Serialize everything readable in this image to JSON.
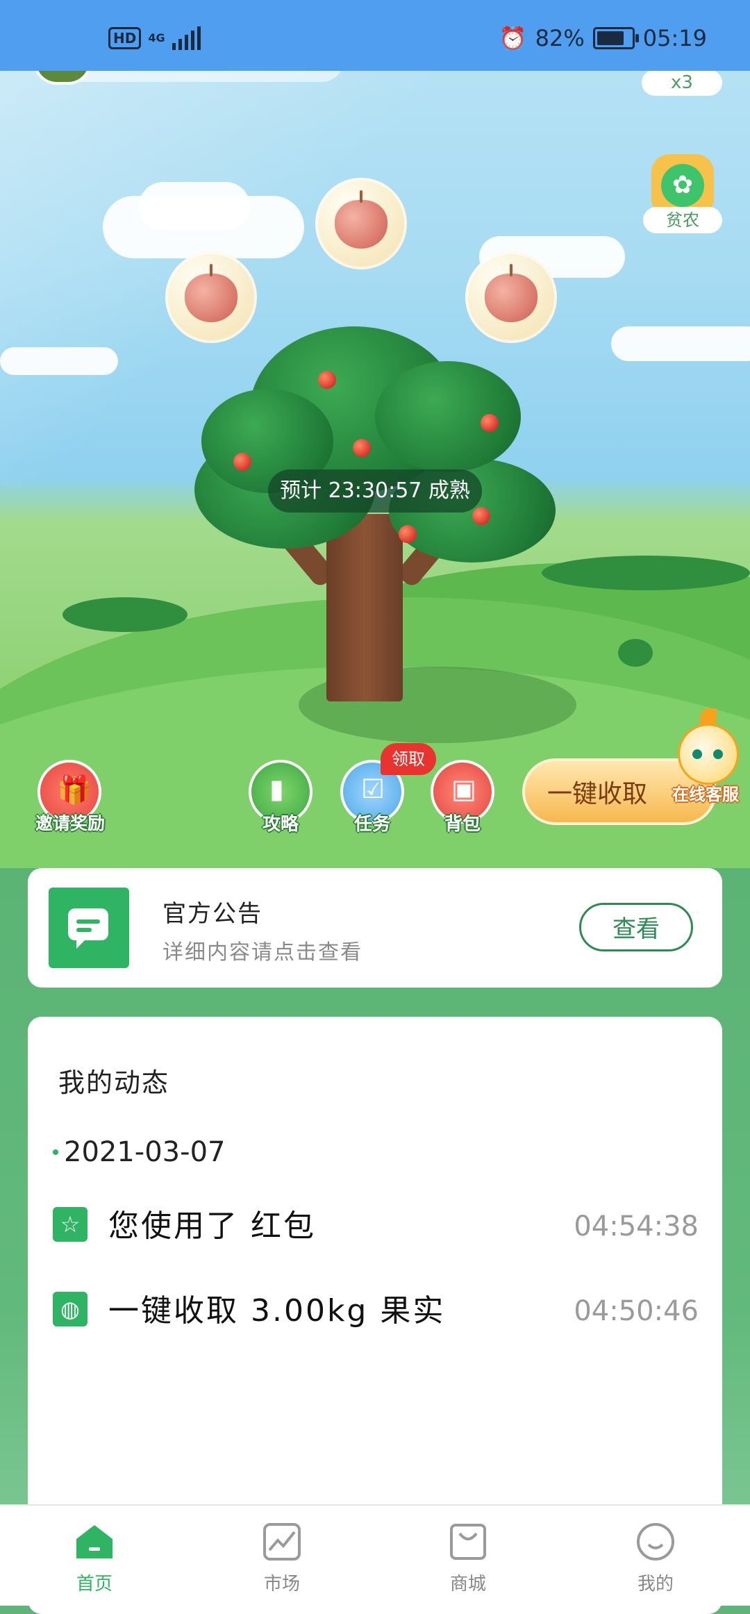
{
  "status_bar": {
    "hd": "HD",
    "network": "4G",
    "battery_percent": "82%",
    "time": "05:19",
    "battery_level": 0.82
  },
  "game": {
    "multiplier": "x3",
    "poor_farm_label": "贫农",
    "ripen_text": "预计 23:30:57 成熟"
  },
  "actions": {
    "invite": "邀请奖励",
    "guide": "攻略",
    "tasks": "任务",
    "tasks_badge": "领取",
    "backpack": "背包",
    "harvest_all": "一键收取",
    "customer_service": "在线客服"
  },
  "notice": {
    "title": "官方公告",
    "subtitle": "详细内容请点击查看",
    "view_button": "查看"
  },
  "activity": {
    "title": "我的动态",
    "date": "2021-03-07",
    "logs": [
      {
        "icon": "star-icon",
        "text": "您使用了 红包",
        "time": "04:54:38"
      },
      {
        "icon": "apple-icon",
        "text": "一键收取 3.00kg 果实",
        "time": "04:50:46"
      }
    ]
  },
  "bottom_nav": {
    "items": [
      {
        "label": "首页",
        "icon": "home-icon",
        "active": true
      },
      {
        "label": "市场",
        "icon": "chart-icon",
        "active": false
      },
      {
        "label": "商城",
        "icon": "bag-icon",
        "active": false
      },
      {
        "label": "我的",
        "icon": "smile-icon",
        "active": false
      }
    ]
  },
  "colors": {
    "status_bar": "#4f9ef0",
    "brand_green": "#2fb463",
    "badge_red": "#e8332e"
  }
}
